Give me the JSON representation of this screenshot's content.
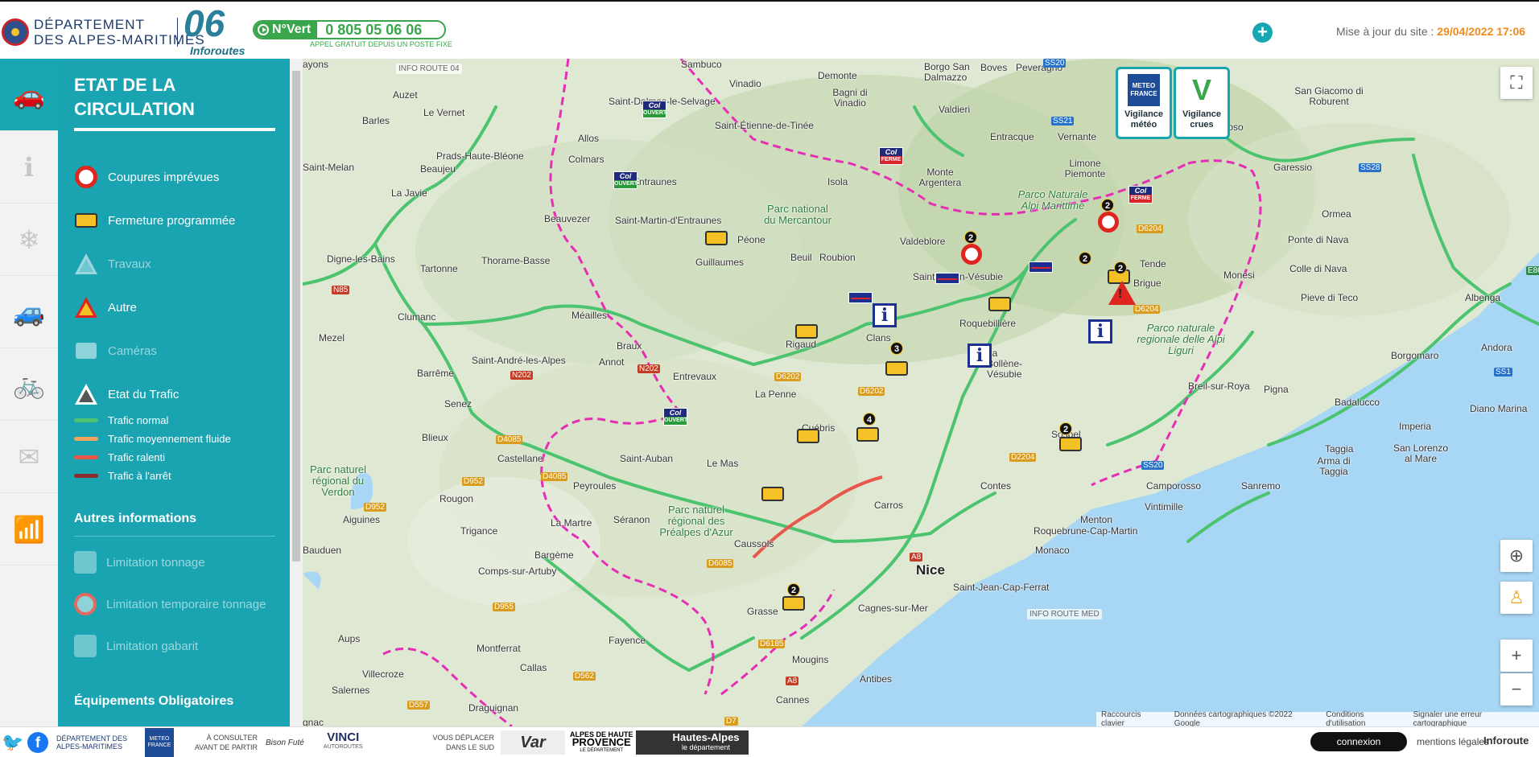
{
  "header": {
    "dept_line1": "DÉPARTEMENT",
    "dept_line2": "DES ALPES-MARITIMES",
    "logo_06": "06",
    "logo_inforoutes": "Inforoutes",
    "numvert_label": "N°Vert",
    "numvert_number": "0 805 05 06 06",
    "numvert_sub": "APPEL GRATUIT DEPUIS UN POSTE FIXE",
    "plus_label": "+",
    "update_label": "Mise à jour du site :",
    "update_date": "29/04/2022 17:06",
    "accent": "#19a6b3"
  },
  "rail": {
    "items": [
      {
        "icon": "car-icon",
        "glyph": "🚗"
      },
      {
        "icon": "info-icon",
        "glyph": "ℹ"
      },
      {
        "icon": "snowflake-icon",
        "glyph": "❄"
      },
      {
        "icon": "cars-icon",
        "glyph": "🚙"
      },
      {
        "icon": "bike-icon",
        "glyph": "🚲"
      },
      {
        "icon": "email-icon",
        "glyph": "✉"
      },
      {
        "icon": "rss-icon",
        "glyph": "📶"
      }
    ]
  },
  "panel": {
    "title": "ETAT DE LA CIRCULATION",
    "legend": [
      {
        "label": "Coupures imprévues"
      },
      {
        "label": "Fermeture programmée"
      },
      {
        "label": "Travaux"
      },
      {
        "label": "Autre"
      },
      {
        "label": "Caméras"
      },
      {
        "label": "Etat du Trafic"
      }
    ],
    "traffic": [
      {
        "label": "Trafic normal",
        "color": "#4cc36f"
      },
      {
        "label": "Trafic moyennement fluide",
        "color": "#f0a35a"
      },
      {
        "label": "Trafic ralenti",
        "color": "#e8584a"
      },
      {
        "label": "Trafic à l'arrêt",
        "color": "#8b2c2c"
      }
    ],
    "other_title": "Autres informations",
    "other": [
      {
        "label": "Limitation tonnage"
      },
      {
        "label": "Limitation temporaire tonnage"
      },
      {
        "label": "Limitation gabarit"
      }
    ],
    "equip_title": "Équipements Obligatoires"
  },
  "map": {
    "info04": "INFO ROUTE 04",
    "info_med": "INFO ROUTE MED",
    "vig_meteo": "Vigilance météo",
    "vig_meteo_logo": "METEO FRANCE",
    "vig_crues": "Vigilance crues",
    "vig_crues_logo": "V",
    "places": [
      {
        "t": "Sambuco"
      },
      {
        "t": "Vinadio"
      },
      {
        "t": "Demonte"
      },
      {
        "t": "Borgo San Dalmazzo"
      },
      {
        "t": "Boves"
      },
      {
        "t": "Peveragno"
      },
      {
        "t": "San Giacomo di Roburent"
      },
      {
        "t": "Auzet"
      },
      {
        "t": "Barles"
      },
      {
        "t": "Le Vernet"
      },
      {
        "t": "Saint-Dalmas-le-Selvage"
      },
      {
        "t": "Saint-Étienne-de-Tinée"
      },
      {
        "t": "Bagni di Vinadio"
      },
      {
        "t": "Valdieri"
      },
      {
        "t": "Entracque"
      },
      {
        "t": "Vernante"
      },
      {
        "t": "Prato Nevoso"
      },
      {
        "t": "Allos"
      },
      {
        "t": "Prads-Haute-Bléone"
      },
      {
        "t": "Isola"
      },
      {
        "t": "Limone Piemonte"
      },
      {
        "t": "Garessio"
      },
      {
        "t": "Saint-Melan"
      },
      {
        "t": "Beaujeu"
      },
      {
        "t": "Colmars"
      },
      {
        "t": "Entraunes"
      },
      {
        "t": "Monte Argentera"
      },
      {
        "t": "La Javie"
      },
      {
        "t": "Beauvezer"
      },
      {
        "t": "Saint-Martin-d'Entraunes"
      },
      {
        "t": "Péone"
      },
      {
        "t": "Valdeblore"
      },
      {
        "t": "Ormea"
      },
      {
        "t": "Digne-les-Bains"
      },
      {
        "t": "Tartonne"
      },
      {
        "t": "Thorame-Basse"
      },
      {
        "t": "Guillaumes"
      },
      {
        "t": "Beuil"
      },
      {
        "t": "Roubion"
      },
      {
        "t": "Saint-Martin-Vésubie"
      },
      {
        "t": "Tende"
      },
      {
        "t": "Ponte di Nava"
      },
      {
        "t": "Colle di Nava"
      },
      {
        "t": "Monesi"
      },
      {
        "t": "Brigue"
      },
      {
        "t": "Pieve di Teco"
      },
      {
        "t": "Albenga"
      },
      {
        "t": "Clumanc"
      },
      {
        "t": "Méailles"
      },
      {
        "t": "Roquebillière"
      },
      {
        "t": "Mezel"
      },
      {
        "t": "Rigaud"
      },
      {
        "t": "Clans"
      },
      {
        "t": "Borgomaro"
      },
      {
        "t": "Andora"
      },
      {
        "t": "Barrême"
      },
      {
        "t": "Saint-André-les-Alpes"
      },
      {
        "t": "Braux"
      },
      {
        "t": "Annot"
      },
      {
        "t": "La Bollène-Vésubie"
      },
      {
        "t": "Entrevaux"
      },
      {
        "t": "Breil-sur-Roya"
      },
      {
        "t": "Pigna"
      },
      {
        "t": "Senez"
      },
      {
        "t": "La Penne"
      },
      {
        "t": "Badalucco"
      },
      {
        "t": "Diano Marina"
      },
      {
        "t": "Imperia"
      },
      {
        "t": "Cuébris"
      },
      {
        "t": "Sospel"
      },
      {
        "t": "Blieux"
      },
      {
        "t": "Castellane"
      },
      {
        "t": "Saint-Auban"
      },
      {
        "t": "Le Mas"
      },
      {
        "t": "Taggia"
      },
      {
        "t": "Arma di Taggia"
      },
      {
        "t": "San Lorenzo al Mare"
      },
      {
        "t": "Contes"
      },
      {
        "t": "Peyroules"
      },
      {
        "t": "Camporosso"
      },
      {
        "t": "Sanremo"
      },
      {
        "t": "Vintimille"
      },
      {
        "t": "Rougon"
      },
      {
        "t": "Carros"
      },
      {
        "t": "Aiguines"
      },
      {
        "t": "La Martre"
      },
      {
        "t": "Séranon"
      },
      {
        "t": "Menton"
      },
      {
        "t": "Trigance"
      },
      {
        "t": "Roquebrune-Cap-Martin"
      },
      {
        "t": "Bargème"
      },
      {
        "t": "Caussols"
      },
      {
        "t": "Monaco"
      },
      {
        "t": "Bauduen"
      },
      {
        "t": "Comps-sur-Artuby"
      },
      {
        "t": "Nice"
      },
      {
        "t": "Saint-Jean-Cap-Ferrat"
      },
      {
        "t": "Grasse"
      },
      {
        "t": "Cagnes-sur-Mer"
      },
      {
        "t": "Aups"
      },
      {
        "t": "Fayence"
      },
      {
        "t": "Montferrat"
      },
      {
        "t": "Callas"
      },
      {
        "t": "Mougins"
      },
      {
        "t": "Villecroze"
      },
      {
        "t": "Antibes"
      },
      {
        "t": "Salernes"
      },
      {
        "t": "Draguignan"
      },
      {
        "t": "Cannes"
      },
      {
        "t": "ayons"
      },
      {
        "t": "gnac"
      }
    ],
    "parks": [
      {
        "t": "Parco Naturale Alpi Marittime"
      },
      {
        "t": "Parc national du Mercantour"
      },
      {
        "t": "Parco naturale regionale delle Alpi Liguri"
      },
      {
        "t": "Parc naturel régional du Verdon"
      },
      {
        "t": "Parc naturel régional des Préalpes d'Azur"
      }
    ],
    "roads": [
      {
        "t": "SS20"
      },
      {
        "t": "SS21"
      },
      {
        "t": "N85"
      },
      {
        "t": "N202"
      },
      {
        "t": "N202"
      },
      {
        "t": "D6202"
      },
      {
        "t": "D6202"
      },
      {
        "t": "D6204"
      },
      {
        "t": "D2204"
      },
      {
        "t": "SS20"
      },
      {
        "t": "D4085"
      },
      {
        "t": "D4085"
      },
      {
        "t": "D952"
      },
      {
        "t": "D952"
      },
      {
        "t": "D6085"
      },
      {
        "t": "D955"
      },
      {
        "t": "D562"
      },
      {
        "t": "D6185"
      },
      {
        "t": "D557"
      },
      {
        "t": "A8"
      },
      {
        "t": "A8"
      },
      {
        "t": "E80"
      },
      {
        "t": "SS1"
      },
      {
        "t": "D7"
      },
      {
        "t": "SS28"
      },
      {
        "t": "D6204"
      }
    ],
    "col_ouvert_label": "Col",
    "col_ouvert_state": "OUVERT",
    "col_ferme_state": "FERME",
    "counts": [
      "2",
      "2",
      "2",
      "2",
      "3",
      "4",
      "2",
      "2"
    ],
    "attribution": {
      "shortcuts": "Raccourcis clavier",
      "data": "Données cartographiques ©2022 Google",
      "terms": "Conditions d'utilisation",
      "report": "Signaler une erreur cartographique"
    }
  },
  "footer": {
    "twitter": "🐦",
    "facebook": "f",
    "dept": "DÉPARTEMENT DES ALPES-MARITIMES",
    "meteo": "METEO FRANCE",
    "consult_1": "À CONSULTER",
    "consult_2": "AVANT DE PARTIR",
    "bison": "Bison Futé",
    "vinci": "VINCI",
    "vinci_sub": "AUTOROUTES",
    "south_1": "VOUS DÉPLACER",
    "south_2": "DANS LE SUD",
    "var": "Var",
    "ahp_1": "ALPES DE HAUTE",
    "ahp_2": "PROVENCE",
    "ahp_3": "LE DÉPARTEMENT",
    "ha_1": "Hautes-Alpes",
    "ha_2": "le département",
    "connexion": "connexion",
    "mentions": "mentions légales",
    "inforoute": "Inforoute"
  }
}
